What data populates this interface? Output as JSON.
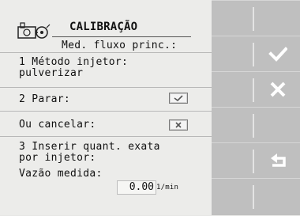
{
  "header": {
    "logo_icon": "flow-calibration-icon",
    "title": "CALIBRAÇÃO",
    "subtitle": "Med. fluxo princ.:"
  },
  "steps": {
    "step1": "1 Método injetor:\npulverizar",
    "step2": "2 Parar:",
    "cancel": "Ou cancelar:",
    "step3": "3 Inserir quant. exata\npor injetor:",
    "measured_label": "Vazão medida:"
  },
  "measurement": {
    "value": "0.00",
    "unit": "1/min"
  },
  "side_buttons": [
    {
      "name": "side-button-1",
      "icon": ""
    },
    {
      "name": "side-button-confirm",
      "icon": "check-icon"
    },
    {
      "name": "side-button-cancel",
      "icon": "close-icon"
    },
    {
      "name": "side-button-4",
      "icon": ""
    },
    {
      "name": "side-button-back",
      "icon": "return-icon"
    },
    {
      "name": "side-button-6",
      "icon": ""
    }
  ],
  "colors": {
    "panel": "#ececea",
    "sidebar": "#bfbfbf",
    "icon_white": "#ffffff"
  }
}
